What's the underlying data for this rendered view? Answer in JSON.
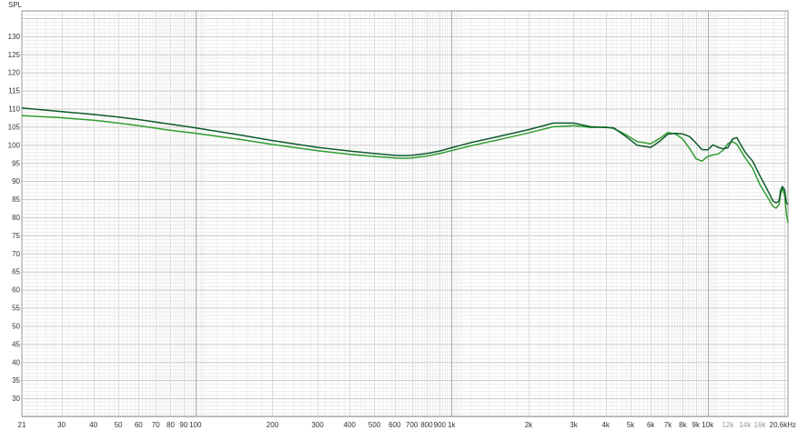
{
  "chart_data": {
    "type": "line",
    "title": "",
    "ylabel": "SPL",
    "xscale": "log",
    "xlim": [
      21,
      20600
    ],
    "ylim": [
      25,
      137
    ],
    "grid": true,
    "yticks": [
      30,
      35,
      40,
      45,
      50,
      55,
      60,
      65,
      70,
      75,
      80,
      85,
      90,
      95,
      100,
      105,
      110,
      115,
      120,
      125,
      130
    ],
    "ytick_labels": [
      "30",
      "35",
      "40",
      "45",
      "50",
      "55",
      "60",
      "65",
      "70",
      "75",
      "80",
      "85",
      "90",
      "95",
      "100",
      "105",
      "110",
      "115",
      "120",
      "125",
      "130"
    ],
    "xticks": [
      {
        "v": 21,
        "label": "21"
      },
      {
        "v": 30,
        "label": "30"
      },
      {
        "v": 40,
        "label": "40"
      },
      {
        "v": 50,
        "label": "50"
      },
      {
        "v": 60,
        "label": "60"
      },
      {
        "v": 70,
        "label": "70"
      },
      {
        "v": 80,
        "label": "80"
      },
      {
        "v": 90,
        "label": "90"
      },
      {
        "v": 100,
        "label": "100"
      },
      {
        "v": 200,
        "label": "200"
      },
      {
        "v": 300,
        "label": "300"
      },
      {
        "v": 400,
        "label": "400"
      },
      {
        "v": 500,
        "label": "500"
      },
      {
        "v": 600,
        "label": "600"
      },
      {
        "v": 700,
        "label": "700"
      },
      {
        "v": 800,
        "label": "800"
      },
      {
        "v": 900,
        "label": "900"
      },
      {
        "v": 1000,
        "label": "1k"
      },
      {
        "v": 2000,
        "label": "2k"
      },
      {
        "v": 3000,
        "label": "3k"
      },
      {
        "v": 4000,
        "label": "4k"
      },
      {
        "v": 5000,
        "label": "5k"
      },
      {
        "v": 6000,
        "label": "6k"
      },
      {
        "v": 7000,
        "label": "7k"
      },
      {
        "v": 8000,
        "label": "8k"
      },
      {
        "v": 9000,
        "label": "9k"
      },
      {
        "v": 10000,
        "label": "10k"
      },
      {
        "v": 12000,
        "label": "12k",
        "dim": true
      },
      {
        "v": 14000,
        "label": "14k",
        "dim": true
      },
      {
        "v": 16000,
        "label": "16k",
        "dim": true
      },
      {
        "v": 20600,
        "label": "20,6kHz"
      }
    ],
    "series": [
      {
        "color": "#0e5a2c",
        "x": [
          21,
          30,
          40,
          50,
          60,
          70,
          80,
          100,
          150,
          200,
          300,
          400,
          500,
          600,
          650,
          700,
          800,
          900,
          1000,
          1200,
          1500,
          2000,
          2500,
          3000,
          3500,
          4000,
          4300,
          4800,
          5300,
          6000,
          6500,
          7000,
          7500,
          8000,
          8500,
          9000,
          9500,
          10000,
          10500,
          11000,
          11500,
          12000,
          12500,
          13000,
          14000,
          15000,
          16000,
          17000,
          18000,
          18500,
          19000,
          19300,
          19600,
          20000,
          20300,
          20600
        ],
        "y": [
          110.2,
          109.2,
          108.4,
          107.7,
          107,
          106.3,
          105.7,
          104.7,
          102.7,
          101.2,
          99.3,
          98.3,
          97.6,
          97.1,
          97,
          97.1,
          97.6,
          98.3,
          99.2,
          100.7,
          102.2,
          104.2,
          106,
          106,
          105,
          104.8,
          104.7,
          102.3,
          99.9,
          99.3,
          101,
          103,
          103.2,
          103,
          102.3,
          100.5,
          98.7,
          98.6,
          100,
          99.3,
          98.9,
          99.2,
          101.6,
          102,
          98,
          95.5,
          91.5,
          88,
          84.5,
          84,
          84.5,
          87.5,
          88.5,
          87.5,
          84,
          83.5
        ]
      },
      {
        "color": "#2f9d2f",
        "x": [
          21,
          30,
          40,
          50,
          60,
          70,
          80,
          100,
          150,
          200,
          300,
          400,
          500,
          600,
          650,
          700,
          800,
          900,
          1000,
          1200,
          1500,
          2000,
          2500,
          3000,
          3500,
          4000,
          4300,
          4800,
          5300,
          6000,
          6500,
          7000,
          7500,
          8000,
          8500,
          9000,
          9500,
          10000,
          10500,
          11000,
          11500,
          12000,
          12500,
          13000,
          14000,
          15000,
          16000,
          17000,
          18000,
          18500,
          19000,
          19300,
          19600,
          20000,
          20300,
          20600
        ],
        "y": [
          108.1,
          107.5,
          106.8,
          106,
          105.3,
          104.6,
          104,
          103.2,
          101.5,
          100.1,
          98.4,
          97.4,
          96.8,
          96.4,
          96.3,
          96.4,
          96.9,
          97.6,
          98.4,
          99.8,
          101.3,
          103.3,
          105,
          105.3,
          104.8,
          104.9,
          104.5,
          102.8,
          100.9,
          100.3,
          101.8,
          103.4,
          103,
          101.6,
          99,
          96.2,
          95.5,
          96.8,
          97.2,
          97.5,
          98.5,
          100.3,
          100.9,
          100.2,
          96.5,
          93.5,
          89,
          86,
          83,
          82.5,
          83.5,
          86.5,
          88,
          86,
          81,
          78.5
        ]
      }
    ]
  }
}
